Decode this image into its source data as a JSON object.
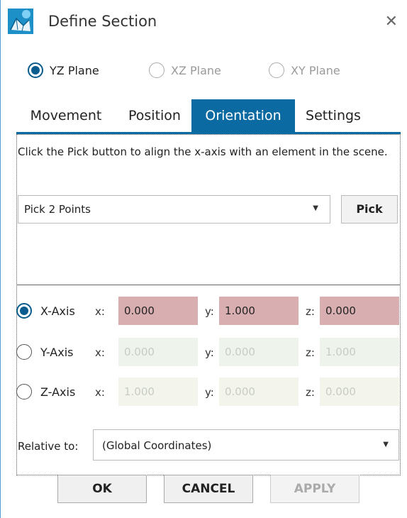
{
  "window": {
    "title": "Define Section",
    "close_glyph": "✕",
    "app_icon": "network-mesh-icon"
  },
  "planes": [
    {
      "label": "YZ Plane",
      "checked": true
    },
    {
      "label": "XZ Plane",
      "checked": false
    },
    {
      "label": "XY Plane",
      "checked": false
    }
  ],
  "tabs": [
    {
      "label": "Movement",
      "active": false
    },
    {
      "label": "Position",
      "active": false
    },
    {
      "label": "Orientation",
      "active": true
    },
    {
      "label": "Settings",
      "active": false
    }
  ],
  "orientation": {
    "hint": "Click the Pick button to align the x-axis with an element in the scene.",
    "pick_mode": "Pick 2 Points",
    "pick_button": "Pick",
    "axes": [
      {
        "label": "X-Axis",
        "checked": true,
        "x": "0.000",
        "y": "1.000",
        "z": "0.000"
      },
      {
        "label": "Y-Axis",
        "checked": false,
        "x": "0.000",
        "y": "0.000",
        "z": "1.000"
      },
      {
        "label": "Z-Axis",
        "checked": false,
        "x": "1.000",
        "y": "0.000",
        "z": "0.000"
      }
    ],
    "coord_labels": {
      "x": "x:",
      "y": "y:",
      "z": "z:"
    },
    "relative_to_label": "Relative to:",
    "relative_to_value": "(Global Coordinates)"
  },
  "buttons": {
    "ok": "OK",
    "cancel": "CANCEL",
    "apply": "APPLY"
  },
  "colors": {
    "accent": "#0a6aa1",
    "active_field": "#d8aeb0",
    "inactive_field": "#eef4ec"
  }
}
